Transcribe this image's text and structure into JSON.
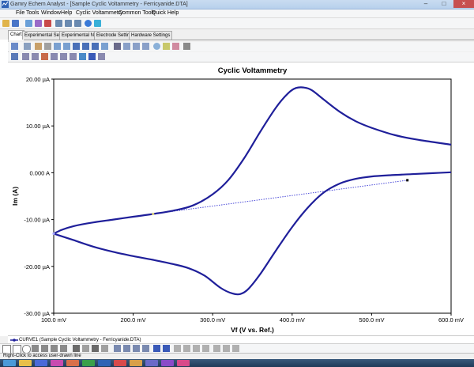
{
  "window": {
    "title": "Gamry Echem Analyst - [Sample Cyclic Voltammetry - Ferricyanide.DTA]",
    "minimize": "–",
    "maximize": "□",
    "close": "×"
  },
  "menu": {
    "items": [
      "File",
      "Tools",
      "Window",
      "Help",
      "Cyclic Voltammetry",
      "Common Tools",
      "Quick Help"
    ]
  },
  "tabs": {
    "items": [
      "Chart",
      "Experimental Setup",
      "Experimental Notes",
      "Electrode Settings",
      "Hardware Settings"
    ],
    "active": "Chart"
  },
  "legend": {
    "curve_label": "CURVE1 (Sample Cyclic Voltammetry - Ferricyanide.DTA)"
  },
  "status": {
    "text": "Right-Click to access user-drawn line"
  },
  "colors": {
    "curve": "#1f1f9a",
    "line": "#4a4ad8"
  },
  "chart_data": {
    "type": "line",
    "title": "Cyclic Voltammetry",
    "xlabel": "Vf (V vs. Ref.)",
    "ylabel": "Im (A)",
    "xlim": [
      100,
      600
    ],
    "ylim": [
      -30,
      20
    ],
    "x_ticks": [
      100,
      200,
      300,
      400,
      500,
      600
    ],
    "x_tick_labels": [
      "100.0 mV",
      "200.0 mV",
      "300.0 mV",
      "400.0 mV",
      "500.0 mV",
      "600.0 mV"
    ],
    "y_ticks": [
      20,
      10,
      0,
      -10,
      -20,
      -30
    ],
    "y_tick_labels": [
      "20.00 µA",
      "10.00 µA",
      "0.000 A",
      "-10.00 µA",
      "-20.00 µA",
      "-30.00 µA"
    ],
    "grid": false,
    "series": [
      {
        "x": [
          100,
          110,
          125,
          150,
          175,
          200,
          225,
          250,
          275,
          300,
          320,
          340,
          360,
          380,
          395,
          405,
          415,
          425,
          440,
          460,
          480,
          500,
          530,
          560,
          600
        ],
        "y": [
          -13.0,
          -12.2,
          -11.4,
          -10.6,
          -10.0,
          -9.4,
          -8.8,
          -8.1,
          -7.0,
          -4.6,
          -1.5,
          3.2,
          8.8,
          14.0,
          17.0,
          18.1,
          18.2,
          17.6,
          15.6,
          13.0,
          11.0,
          9.6,
          8.0,
          7.0,
          6.0
        ]
      },
      {
        "x": [
          600,
          575,
          550,
          525,
          500,
          480,
          460,
          440,
          420,
          400,
          380,
          360,
          345,
          335,
          325,
          310,
          290,
          270,
          250,
          225,
          200,
          175,
          150,
          125,
          100
        ],
        "y": [
          0.1,
          -0.1,
          -0.3,
          -0.5,
          -0.8,
          -1.3,
          -2.3,
          -4.2,
          -7.4,
          -11.6,
          -16.5,
          -21.6,
          -24.8,
          -25.9,
          -25.8,
          -24.6,
          -22.0,
          -20.4,
          -19.5,
          -18.6,
          -17.8,
          -16.9,
          -15.8,
          -14.4,
          -13.0
        ]
      }
    ],
    "user_line": {
      "x": [
        225,
        545
      ],
      "y": [
        -8.8,
        -1.6
      ]
    }
  }
}
